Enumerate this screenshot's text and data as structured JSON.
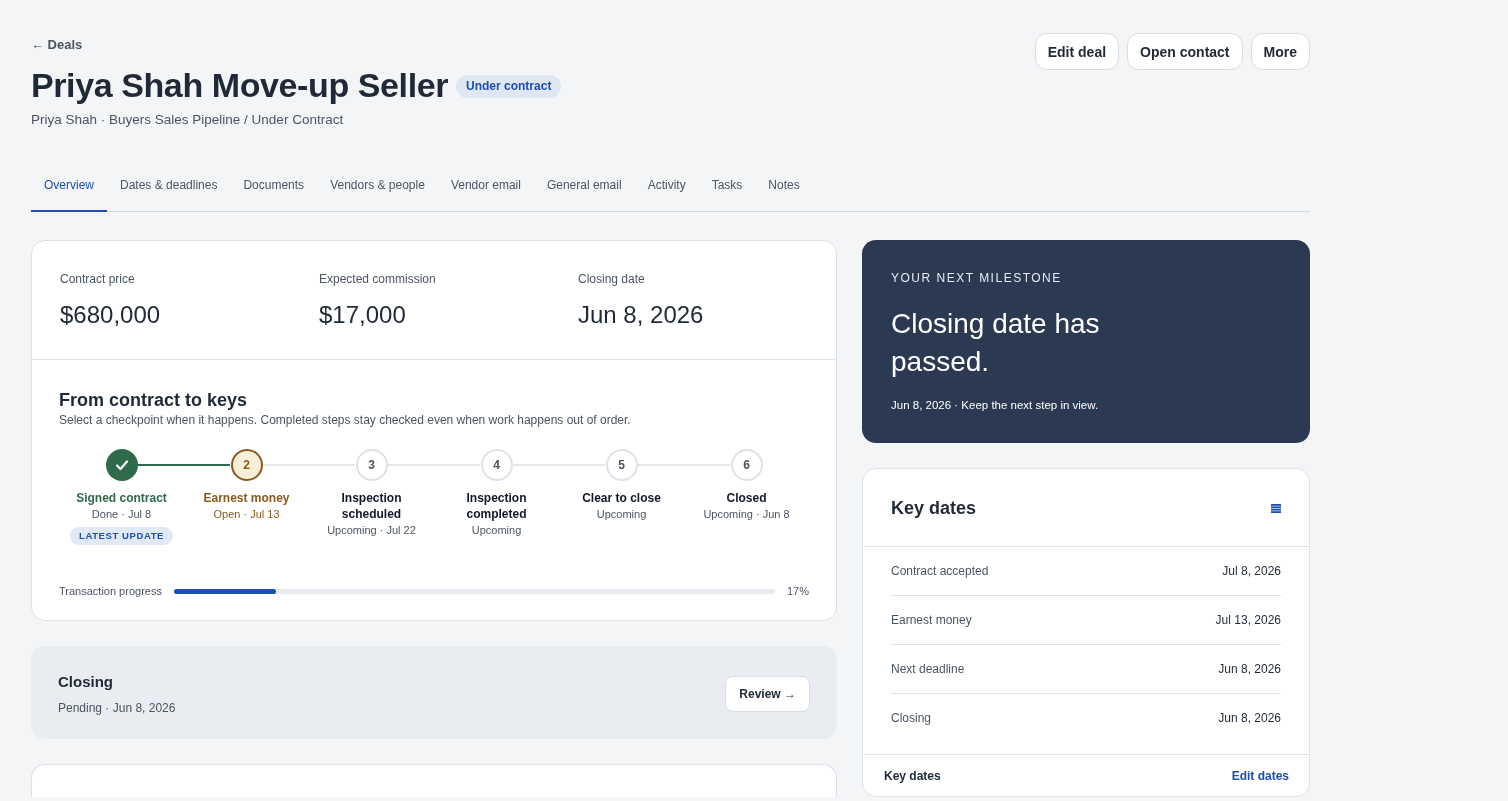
{
  "back_link": {
    "label": "← Deals"
  },
  "header": {
    "title": "Priya Shah Move-up Seller",
    "status_badge": "Under contract",
    "subtitle": "Priya Shah · Buyers Sales Pipeline / Under Contract"
  },
  "actions": [
    {
      "label": "Edit deal"
    },
    {
      "label": "Open contact"
    },
    {
      "label": "More"
    }
  ],
  "tabs": [
    {
      "label": "Overview",
      "selected": true
    },
    {
      "label": "Dates & deadlines",
      "selected": false
    },
    {
      "label": "Documents",
      "selected": false
    },
    {
      "label": "Vendors & people",
      "selected": false
    },
    {
      "label": "Vendor email",
      "selected": false
    },
    {
      "label": "General email",
      "selected": false
    },
    {
      "label": "Activity",
      "selected": false
    },
    {
      "label": "Tasks",
      "selected": false
    },
    {
      "label": "Notes",
      "selected": false
    }
  ],
  "summary": {
    "stats": [
      {
        "label": "Contract price",
        "value": "$680,000"
      },
      {
        "label": "Expected commission",
        "value": "$17,000"
      },
      {
        "label": "Closing date",
        "value": "Jun 8, 2026"
      }
    ]
  },
  "timeline": {
    "title": "From contract to keys",
    "description": "Select a checkpoint when it happens. Completed steps stay checked even when work happens out of order.",
    "steps": [
      {
        "kind": "done",
        "label": "Signed contract",
        "detail": "Done · Jul 8",
        "badge": "LATEST UPDATE"
      },
      {
        "kind": "open",
        "number": "2",
        "label": "Earnest money",
        "detail": "Open · Jul 13"
      },
      {
        "kind": "upcoming",
        "number": "3",
        "label": "Inspection scheduled",
        "detail": "Upcoming · Jul 22"
      },
      {
        "kind": "upcoming",
        "number": "4",
        "label": "Inspection completed",
        "detail": "Upcoming"
      },
      {
        "kind": "upcoming",
        "number": "5",
        "label": "Clear to close",
        "detail": "Upcoming"
      },
      {
        "kind": "upcoming",
        "number": "6",
        "label": "Closed",
        "detail": "Upcoming · Jun 8"
      }
    ],
    "progress": {
      "label": "Transaction progress",
      "level": 0.17,
      "reading": "17%"
    }
  },
  "closing": {
    "title": "Closing",
    "detail": "Pending · Jun 8, 2026",
    "button": "Review →"
  },
  "milestone": {
    "eyebrow": "YOUR NEXT MILESTONE",
    "title": "Closing date has passed.",
    "detail": "Jun 8, 2026 · Keep the next step in view."
  },
  "key_dates": {
    "title": "Key dates",
    "rows": [
      {
        "label": "Contract accepted",
        "date": "Jul 8, 2026"
      },
      {
        "label": "Earnest money",
        "date": "Jul 13, 2026"
      },
      {
        "label": "Next deadline",
        "date": "Jun 8, 2026"
      },
      {
        "label": "Closing",
        "date": "Jun 8, 2026"
      }
    ],
    "footer_label": "Key dates",
    "footer_link": "Edit dates"
  }
}
